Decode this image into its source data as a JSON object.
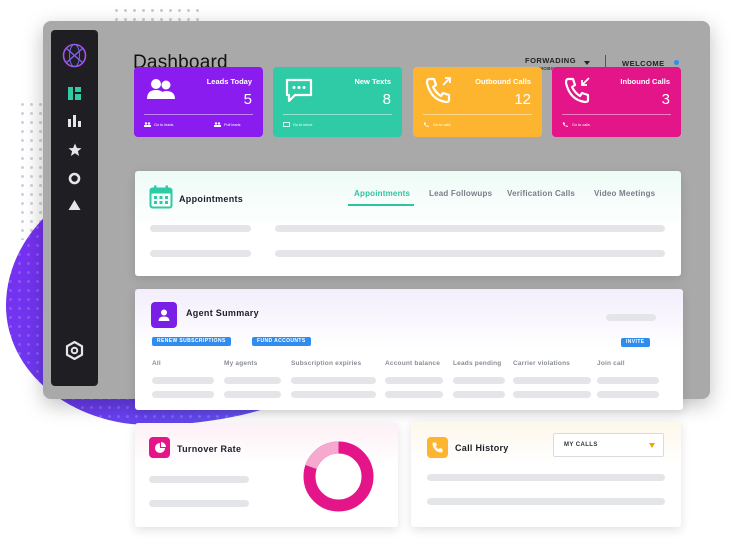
{
  "header": {
    "title": "Dashboard",
    "forwarding_label": "FORWADING",
    "forwarding_sub": "TO MOBILE APP",
    "welcome_label": "WELCOME"
  },
  "colors": {
    "purple": "#8a1cf0",
    "teal": "#2ecba6",
    "orange": "#fdb52f",
    "pink": "#e41489",
    "blue": "#2f8df0"
  },
  "sidebar": {
    "icons": [
      "dashboard-icon",
      "bar-chart-icon",
      "star-icon",
      "circle-icon",
      "triangle-icon",
      "hexagon-settings-icon"
    ]
  },
  "stats": [
    {
      "title": "Leads Today",
      "value": "5",
      "links": [
        "Go to leads",
        "Pull leads"
      ]
    },
    {
      "title": "New Texts",
      "value": "8",
      "links": [
        "Go to inbox"
      ]
    },
    {
      "title": "Outbound Calls",
      "value": "12",
      "links": [
        "Go to calls"
      ]
    },
    {
      "title": "Inbound Calls",
      "value": "3",
      "links": [
        "Go to calls"
      ]
    }
  ],
  "appointments": {
    "title": "Appointments",
    "tabs": [
      "Appointments",
      "Lead Followups",
      "Verification Calls",
      "Video Meetings"
    ],
    "active_tab": "Appointments"
  },
  "agent_summary": {
    "title": "Agent Summary",
    "buttons": [
      "RENEW SUBSCRIPTIONS",
      "FUND ACCOUNTS",
      "INVITE"
    ],
    "columns": [
      "All",
      "My agents",
      "Subscription expiries",
      "Account balance",
      "Leads pending",
      "Carrier violations",
      "Join call"
    ]
  },
  "turnover": {
    "title": "Turnover Rate"
  },
  "call_history": {
    "title": "Call History",
    "filter_value": "MY CALLS"
  }
}
